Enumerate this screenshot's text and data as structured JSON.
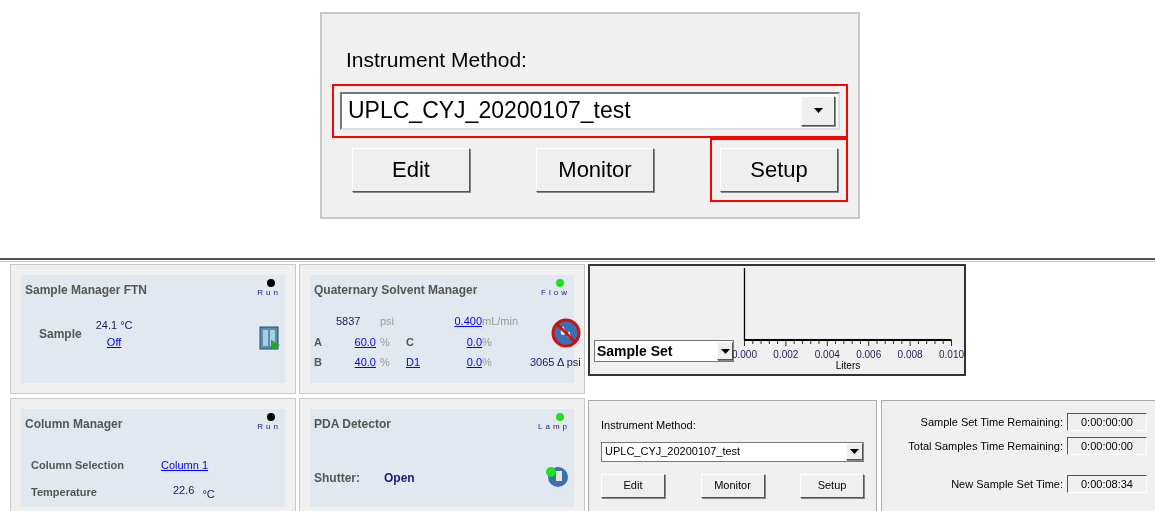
{
  "method_panel_zoomed": {
    "label": "Instrument Method:",
    "method": "UPLC_CYJ_20200107_test",
    "method_highlighted": true,
    "buttons": [
      {
        "label": "Edit",
        "highlighted": false
      },
      {
        "label": "Monitor",
        "highlighted": false
      },
      {
        "label": "Setup",
        "highlighted": true
      }
    ]
  },
  "modules": [
    {
      "title": "Sample Manager FTN",
      "indicator": {
        "label": "Run",
        "color": "#000000"
      },
      "kind": "sample",
      "sample_label": "Sample",
      "temp": "24.1 °C",
      "link": "Off"
    },
    {
      "title": "Quaternary Solvent Manager",
      "indicator": {
        "label": "Flow",
        "color": "#22dd22"
      },
      "kind": "solvent",
      "pressure": "5837",
      "pressure_unit": "psi",
      "flow": "0.400",
      "flow_unit": "mL/min",
      "rows": [
        {
          "c1": "A",
          "v1": "60.0",
          "c2": "C",
          "c2_link": false,
          "v2": "0.0"
        },
        {
          "c1": "B",
          "v1": "40.0",
          "c2": "D1",
          "c2_link": true,
          "v2": "0.0"
        }
      ],
      "pct": "%",
      "delta": "3065 Δ psi"
    },
    {
      "title": "Column Manager",
      "indicator": {
        "label": "Run",
        "color": "#000000"
      },
      "kind": "column",
      "selection_label": "Column Selection",
      "selection": "Column 1",
      "temp_label": "Temperature",
      "temp": "22.6",
      "temp_unit": "°C"
    },
    {
      "title": "PDA Detector",
      "indicator": {
        "label": "Lamp",
        "color": "#22dd22"
      },
      "kind": "pda",
      "shutter_label": "Shutter:",
      "shutter": "Open"
    }
  ],
  "plot": {
    "selector": "Sample Set",
    "axis_title": "Liters",
    "axis_ticks": [
      "0.000",
      "0.002",
      "0.004",
      "0.006",
      "0.008",
      "0.010"
    ]
  },
  "method_panel": {
    "label": "Instrument Method:",
    "method": "UPLC_CYJ_20200107_test",
    "buttons": [
      {
        "label": "Edit"
      },
      {
        "label": "Monitor"
      },
      {
        "label": "Setup"
      }
    ]
  },
  "times": [
    {
      "label": "Sample Set Time Remaining:",
      "value": "0:00:00:00"
    },
    {
      "label": "Total Samples Time Remaining:",
      "value": "0:00:00:00"
    },
    {
      "label": "New Sample Set Time:",
      "value": "0:00:08:34"
    }
  ]
}
